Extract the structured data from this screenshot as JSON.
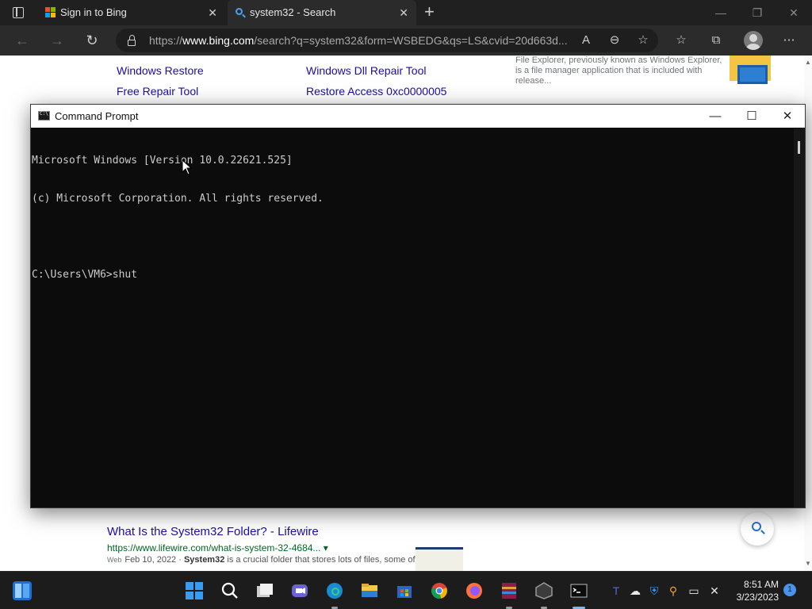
{
  "browser": {
    "tabs": [
      {
        "label": "Sign in to Bing"
      },
      {
        "label": "system32 - Search"
      }
    ],
    "close_glyph": "✕",
    "new_tab_glyph": "+",
    "url_prefix": "https://",
    "url_domain": "www.bing.com",
    "url_path": "/search?q=system32&form=WSBEDG&qs=LS&cvid=20d663d..."
  },
  "page": {
    "links": [
      "Windows Restore",
      "Windows Dll Repair Tool",
      "Free Repair Tool",
      "Restore Access 0xc0000005"
    ],
    "snippet_text": "File Explorer, previously known as Windows Explorer, is a file manager application that is included with release...",
    "lifewire": {
      "title": "What Is the System32 Folder? - Lifewire",
      "url": "https://www.lifewire.com/what-is-system-32-4684...",
      "url_caret": "▾",
      "web_tag": "Web",
      "date": "Feb 10, 2022 · ",
      "bold_term": "System32",
      "snippet_rest": " is a crucial folder that stores lots of files, some of"
    }
  },
  "cmd": {
    "title": "Command Prompt",
    "lines": [
      "Microsoft Windows [Version 10.0.22621.525]",
      "(c) Microsoft Corporation. All rights reserved.",
      "",
      "C:\\Users\\VM6>shut"
    ]
  },
  "taskbar": {
    "time": "8:51 AM",
    "date": "3/23/2023",
    "notification_count": "1"
  },
  "colors": {
    "ms_red": "#f25022",
    "ms_green": "#7fba00",
    "ms_blue": "#00a4ef",
    "ms_yellow": "#ffb900",
    "win_blue": "#3a9bf2"
  }
}
